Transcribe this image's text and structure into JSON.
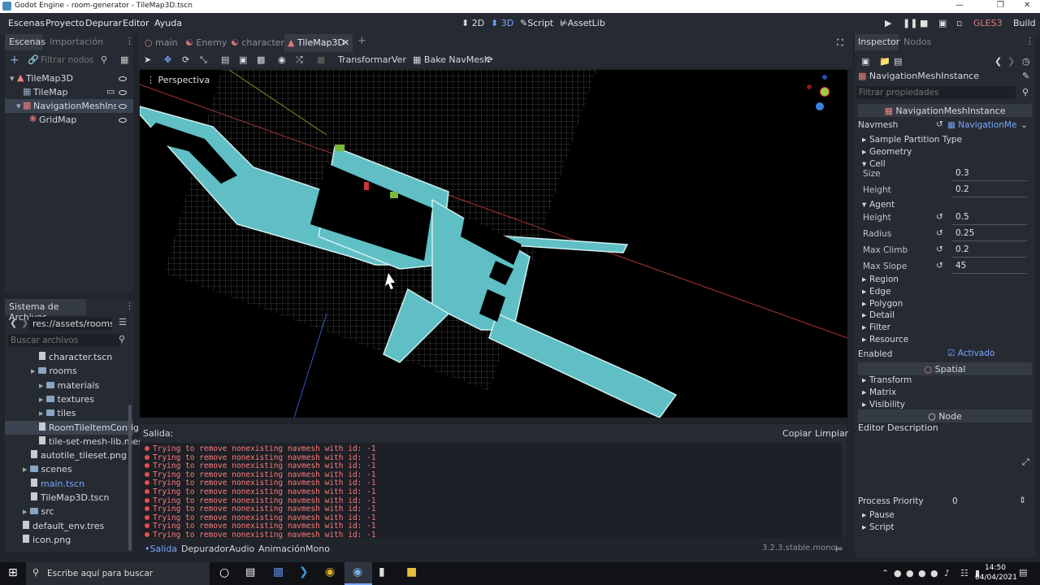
{
  "titlebar": {
    "title": "Godot Engine - room-generator - TileMap3D.tscn"
  },
  "menu": [
    "Escenas",
    "Proyecto",
    "Depurar",
    "Editor",
    "Ayuda"
  ],
  "workspaces": [
    {
      "label": "2D"
    },
    {
      "label": "3D"
    },
    {
      "label": "Script"
    },
    {
      "label": "AssetLib"
    }
  ],
  "build_label": "Build",
  "renderer_label": "GLES3",
  "scene_panel": {
    "tab_scene": "Escenas",
    "tab_import": "Importación",
    "filter_placeholder": "Filtrar nodos",
    "nodes": [
      {
        "label": "TileMap3D",
        "depth": 0
      },
      {
        "label": "TileMap",
        "depth": 1
      },
      {
        "label": "NavigationMeshInstan",
        "depth": 1
      },
      {
        "label": "GridMap",
        "depth": 2
      }
    ]
  },
  "fs_panel": {
    "title": "Sistema de Archivos",
    "path": "res://assets/rooms/Ro",
    "search_placeholder": "Buscar archivos",
    "items": [
      {
        "label": "character.tscn",
        "type": "file",
        "depth": 2
      },
      {
        "label": "rooms",
        "type": "folder",
        "depth": 1
      },
      {
        "label": "materials",
        "type": "folder",
        "depth": 2
      },
      {
        "label": "textures",
        "type": "folder",
        "depth": 2
      },
      {
        "label": "tiles",
        "type": "folder",
        "depth": 2
      },
      {
        "label": "RoomTileItemConfig.",
        "type": "file",
        "depth": 2
      },
      {
        "label": "tile-set-mesh-lib.mes",
        "type": "file",
        "depth": 2
      },
      {
        "label": "autotile_tileset.png",
        "type": "file",
        "depth": 1
      },
      {
        "label": "scenes",
        "type": "folder",
        "depth": 0
      },
      {
        "label": "main.tscn",
        "type": "file",
        "depth": 1
      },
      {
        "label": "TileMap3D.tscn",
        "type": "file",
        "depth": 1
      },
      {
        "label": "src",
        "type": "folder",
        "depth": 0
      },
      {
        "label": "default_env.tres",
        "type": "file",
        "depth": 0
      },
      {
        "label": "icon.png",
        "type": "file",
        "depth": 0
      }
    ]
  },
  "editor_tabs": [
    "main",
    "Enemy",
    "character",
    "TileMap3D"
  ],
  "toolbar3d": {
    "transform": "Transformar",
    "view": "Ver",
    "bake": "Bake NavMesh"
  },
  "viewport": {
    "label": "Perspectiva"
  },
  "output": {
    "title": "Salida:",
    "copy": "Copiar",
    "clear": "Limpiar",
    "lines": [
      "Trying to remove nonexisting navmesh with id: -1",
      "Trying to remove nonexisting navmesh with id: -1",
      "Trying to remove nonexisting navmesh with id: -1",
      "Trying to remove nonexisting navmesh with id: -1",
      "Trying to remove nonexisting navmesh with id: -1",
      "Trying to remove nonexisting navmesh with id: -1",
      "Trying to remove nonexisting navmesh with id: -1",
      "Trying to remove nonexisting navmesh with id: -1",
      "Trying to remove nonexisting navmesh with id: -1",
      "Trying to remove nonexisting navmesh with id: -1",
      "Trying to remove nonexisting navmesh with id: -1"
    ]
  },
  "bottom_tabs": [
    "Salida",
    "Depurador",
    "Audio",
    "Animación",
    "Mono"
  ],
  "version": "3.2.3.stable.mono",
  "inspector": {
    "tab_inspector": "Inspector",
    "tab_nodes": "Nodos",
    "node_name": "NavigationMeshInstance",
    "filter_placeholder": "Filtrar propiedades",
    "class_header": "NavigationMeshInstance",
    "navmesh_label": "Navmesh",
    "navmesh_value": "NavigationMe",
    "sections": [
      "Sample Partition Type",
      "Geometry",
      "Cell"
    ],
    "cell": [
      {
        "label": "Size",
        "value": "0.3"
      },
      {
        "label": "Height",
        "value": "0.2"
      }
    ],
    "agent_label": "Agent",
    "agent": [
      {
        "label": "Height",
        "value": "0.5"
      },
      {
        "label": "Radius",
        "value": "0.25"
      },
      {
        "label": "Max Climb",
        "value": "0.2"
      },
      {
        "label": "Max Slope",
        "value": "45"
      }
    ],
    "more_sections": [
      "Region",
      "Edge",
      "Polygon",
      "Detail",
      "Filter",
      "Resource"
    ],
    "enabled_label": "Enabled",
    "enabled_value": "Activado",
    "spatial_header": "Spatial",
    "spatial_sections": [
      "Transform",
      "Matrix",
      "Visibility"
    ],
    "node_header": "Node",
    "editor_description": "Editor Description",
    "process_priority_label": "Process Priority",
    "process_priority_value": "0",
    "node_sections": [
      "Pause",
      "Script"
    ]
  },
  "taskbar": {
    "search_placeholder": "Escribe aquí para buscar",
    "time": "14:50",
    "date": "04/04/2021"
  },
  "colors": {
    "accent": "#7aa6ff",
    "mesh": "#5fbfc4",
    "error": "#ff7a7a"
  }
}
